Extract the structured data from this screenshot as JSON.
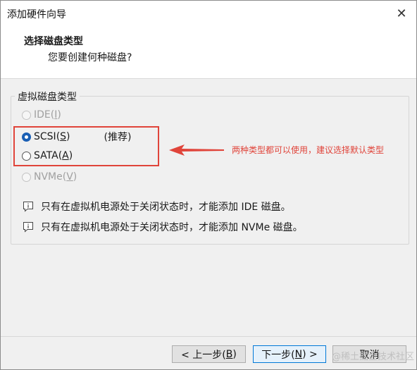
{
  "window": {
    "title": "添加硬件向导"
  },
  "header": {
    "title": "选择磁盘类型",
    "subtitle": "您要创建何种磁盘?"
  },
  "group": {
    "legend": "虚拟磁盘类型"
  },
  "options": [
    {
      "name": "IDE",
      "key": "I",
      "state": "disabled"
    },
    {
      "name": "SCSI",
      "key": "S",
      "state": "selected",
      "tag": "(推荐)"
    },
    {
      "name": "SATA",
      "key": "A",
      "state": "enabled"
    },
    {
      "name": "NVMe",
      "key": "V",
      "state": "disabled"
    }
  ],
  "annotation": {
    "text": "两种类型都可以使用，建议选择默认类型",
    "color": "#e0443a"
  },
  "notes": [
    "只有在虚拟机电源处于关闭状态时，才能添加 IDE 磁盘。",
    "只有在虚拟机电源处于关闭状态时，才能添加 NVMe 磁盘。"
  ],
  "buttons": {
    "back": {
      "prefix": "< 上一步(",
      "key": "B",
      "suffix": ")"
    },
    "next": {
      "prefix": "下一步(",
      "key": "N",
      "suffix": ") >"
    },
    "cancel": "取消"
  },
  "watermark": "@稀土掘金技术社区",
  "colors": {
    "accent": "#1a5fb4",
    "annotation_red": "#e0443a"
  }
}
